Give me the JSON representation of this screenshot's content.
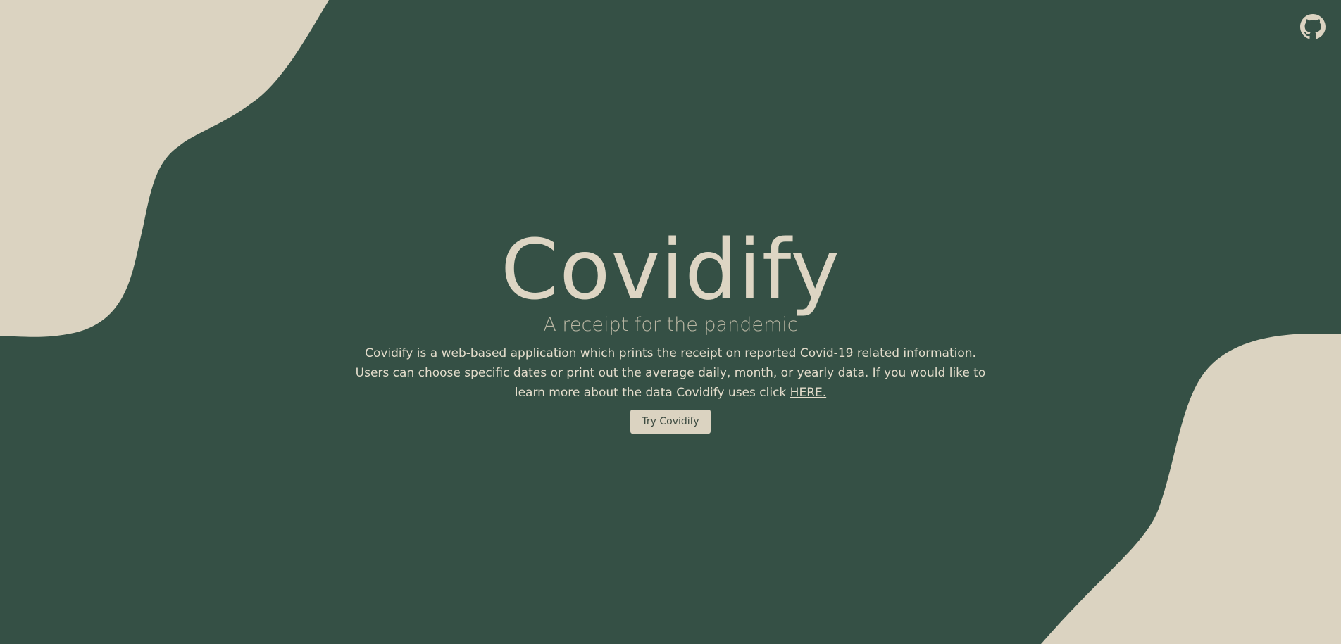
{
  "colors": {
    "background": "#355045",
    "blob": "#dbd3c1",
    "title": "#ddd5c3",
    "subtitle": "#b9b6a3",
    "button_bg": "#dbd3c1",
    "button_text": "#3c4a40"
  },
  "header": {
    "github_icon": "github-icon"
  },
  "hero": {
    "title": "Covidify",
    "subtitle": "A receipt for the pandemic",
    "description_prefix": "Covidify is a web-based application which prints the receipt on reported Covid-19 related information. Users can choose specific dates or print out the average daily, month, or yearly data. If you would like to learn more about the data Covidify uses click ",
    "description_link": "HERE.",
    "cta_label": "Try Covidify"
  }
}
